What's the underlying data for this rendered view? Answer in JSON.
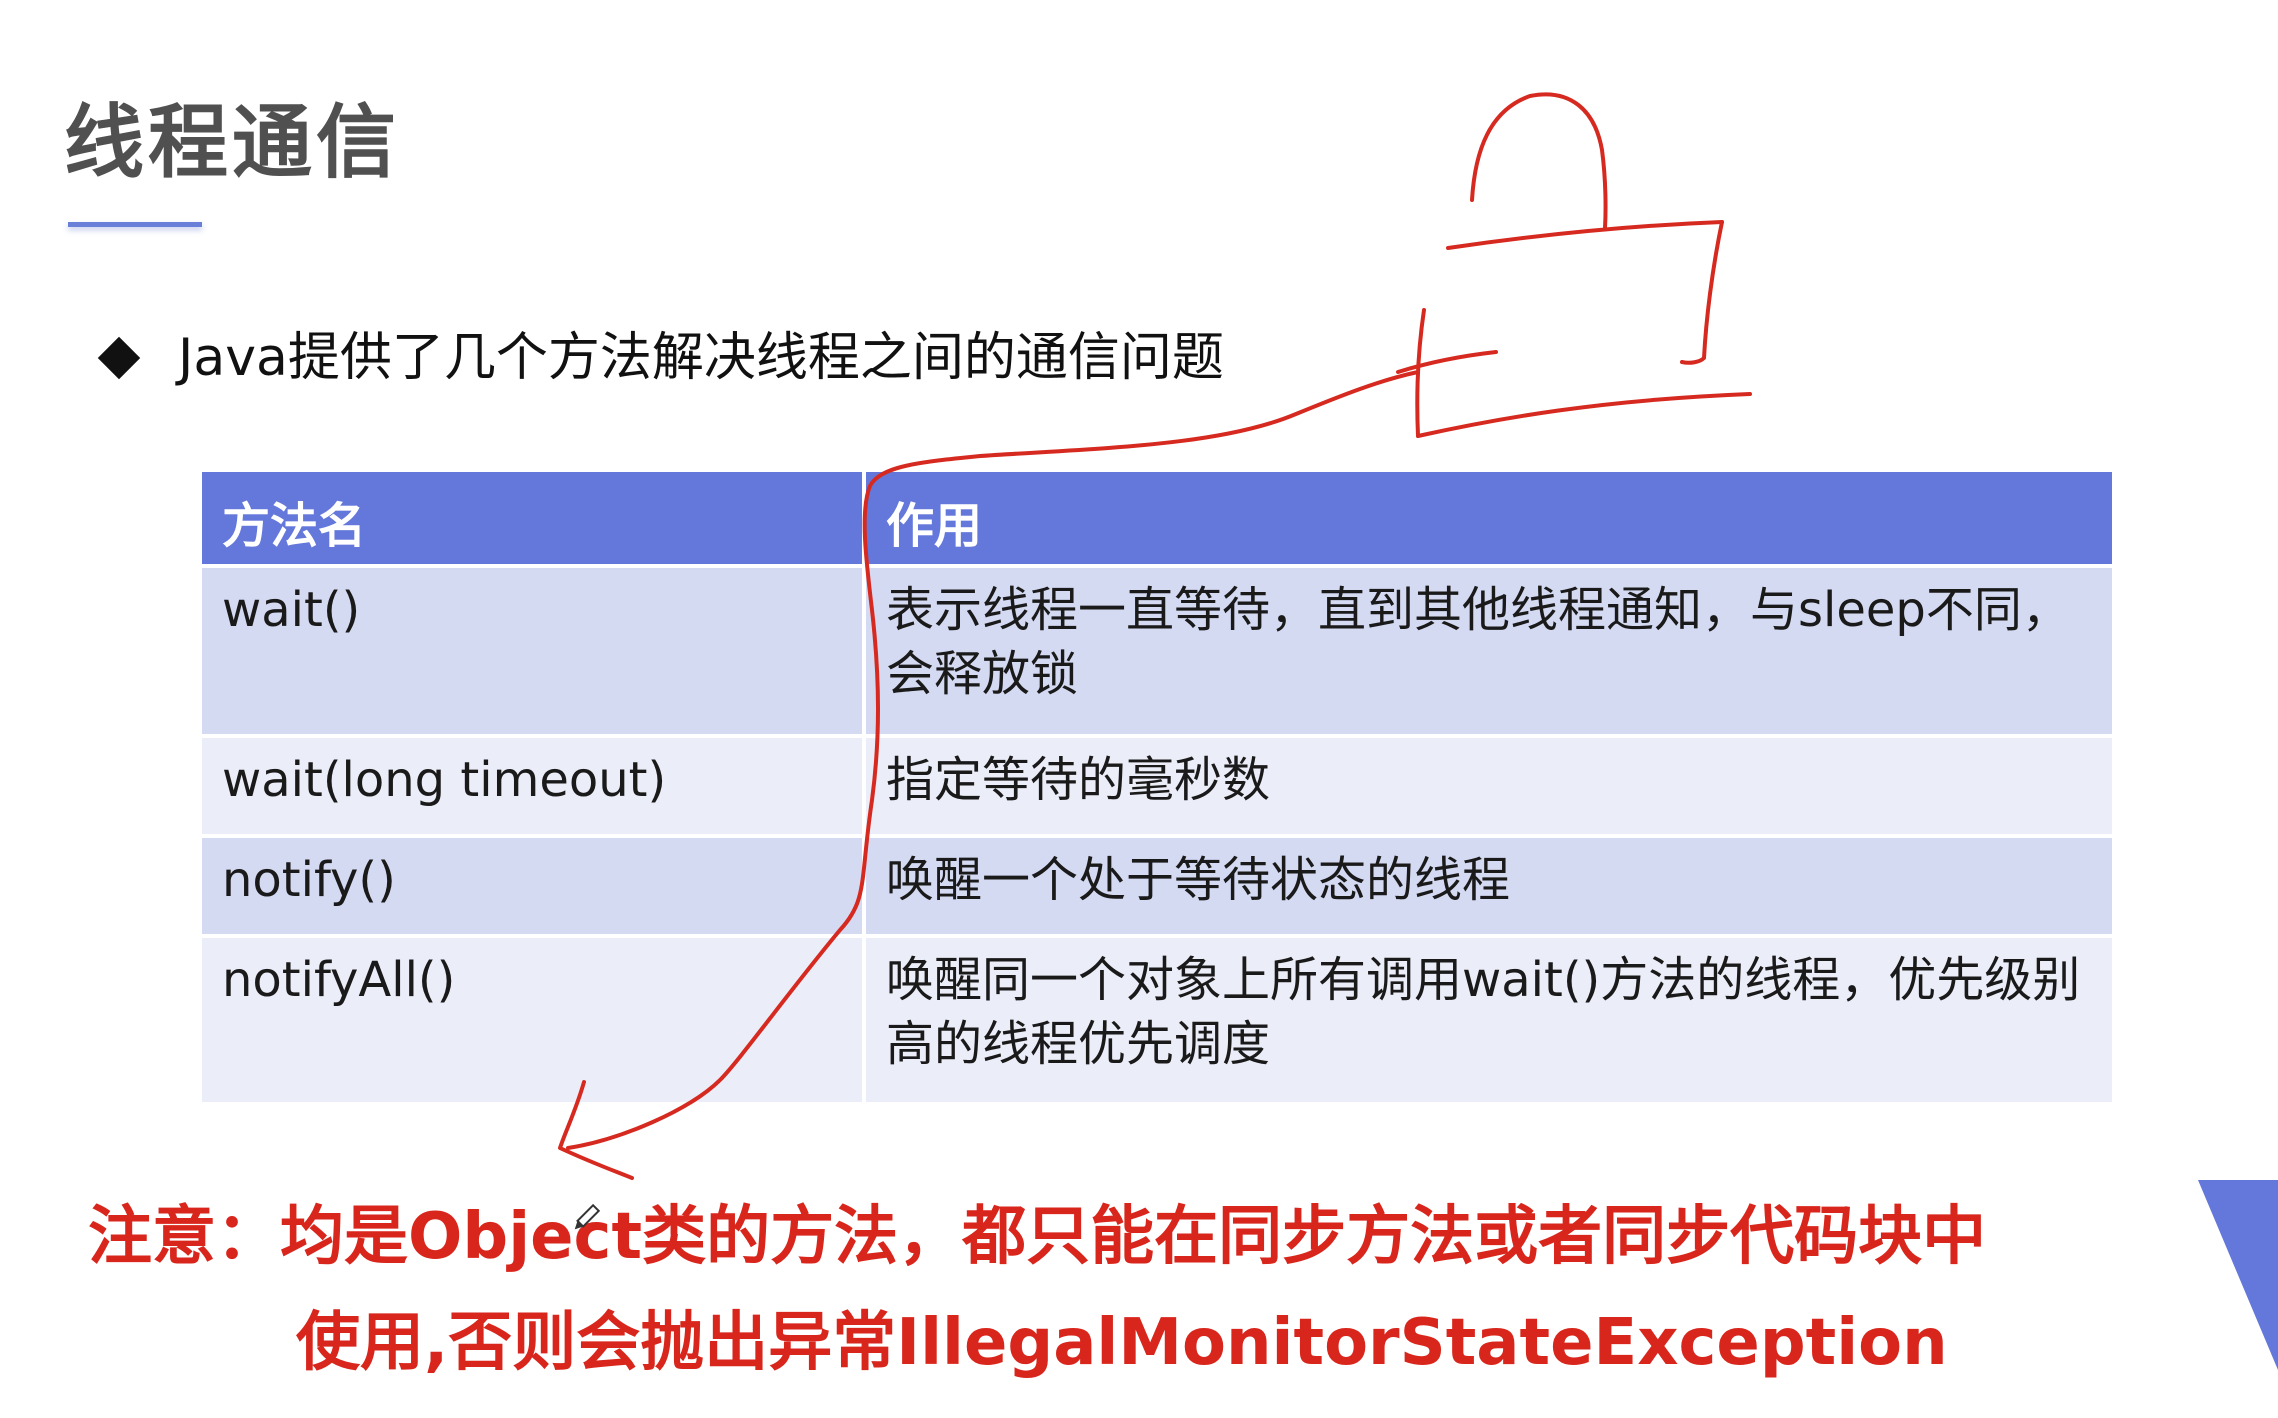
{
  "slide": {
    "title": "线程通信",
    "bullet": "Java提供了几个方法解决线程之间的通信问题"
  },
  "table": {
    "headers": [
      "方法名",
      "作用"
    ],
    "rows": [
      {
        "method": "wait()",
        "description": "表示线程一直等待，直到其他线程通知，与sleep不同，会释放锁"
      },
      {
        "method": "wait(long timeout)",
        "description": "指定等待的毫秒数"
      },
      {
        "method": "notify()",
        "description": "唤醒一个处于等待状态的线程"
      },
      {
        "method": "notifyAll()",
        "description": "唤醒同一个对象上所有调用wait()方法的线程，优先级别高的线程优先调度"
      }
    ]
  },
  "note": {
    "line1": "注意：均是Object类的方法，都只能在同步方法或者同步代码块中",
    "line2": "使用,否则会抛出异常IllegalMonitorStateException"
  },
  "colors": {
    "header_bg": "#6478db",
    "row_odd_bg": "#d5daf3",
    "row_even_bg": "#ebedf8",
    "note_text": "#d9261c",
    "annotation_stroke": "#d62a20",
    "title_text": "#505050",
    "underline": "#6a7fd8"
  }
}
